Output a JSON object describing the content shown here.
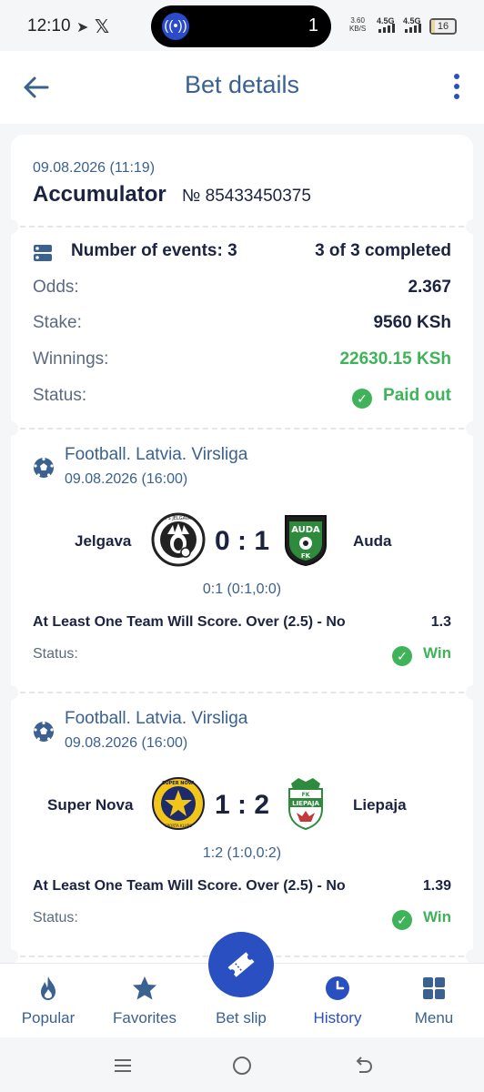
{
  "status_bar": {
    "time": "12:10",
    "pill_count": "1",
    "net_speed": "3.60",
    "net_unit": "KB/S",
    "sig1": "4.5G",
    "sig2": "4.5G",
    "battery": "16",
    "battery_level": 0.16
  },
  "header": {
    "title": "Bet details"
  },
  "summary": {
    "date": "09.08.2026 (11:19)",
    "type": "Accumulator",
    "number": "№ 85433450375",
    "events_label": "Number of events: 3",
    "events_progress": "3 of 3 completed",
    "odds_label": "Odds:",
    "odds_value": "2.367",
    "stake_label": "Stake:",
    "stake_value": "9560 KSh",
    "winnings_label": "Winnings:",
    "winnings_value": "22630.15 KSh",
    "status_label": "Status:",
    "status_value": "Paid out"
  },
  "events": [
    {
      "league": "Football. Latvia. Virsliga",
      "date": "09.08.2026 (16:00)",
      "home": "Jelgava",
      "away": "Auda",
      "score": "0 : 1",
      "sub_score": "0:1 (0:1,0:0)",
      "market": "At Least One Team Will Score. Over (2.5) - No",
      "odd": "1.3",
      "status_label": "Status:",
      "status_value": "Win",
      "home_logo_text": "FS JELGAVA",
      "away_logo_text": "AUDA",
      "away_logo_sub": "FK"
    },
    {
      "league": "Football. Latvia. Virsliga",
      "date": "09.08.2026 (16:00)",
      "home": "Super Nova",
      "away": "Liepaja",
      "score": "1 : 2",
      "sub_score": "1:2 (1:0,0:2)",
      "market": "At Least One Team Will Score. Over (2.5) - No",
      "odd": "1.39",
      "status_label": "Status:",
      "status_value": "Win",
      "home_logo_text": "SUPER NOVA",
      "home_logo_sub": "SPORTA KLUBS",
      "away_logo_text": "LIEPAJA",
      "away_logo_sub": "FK"
    }
  ],
  "bottom_nav": {
    "popular": "Popular",
    "favorites": "Favorites",
    "bet_slip": "Bet slip",
    "history": "History",
    "menu": "Menu"
  },
  "colors": {
    "accent": "#2a4fc1",
    "title": "#3a6190",
    "win": "#3fb35a"
  }
}
